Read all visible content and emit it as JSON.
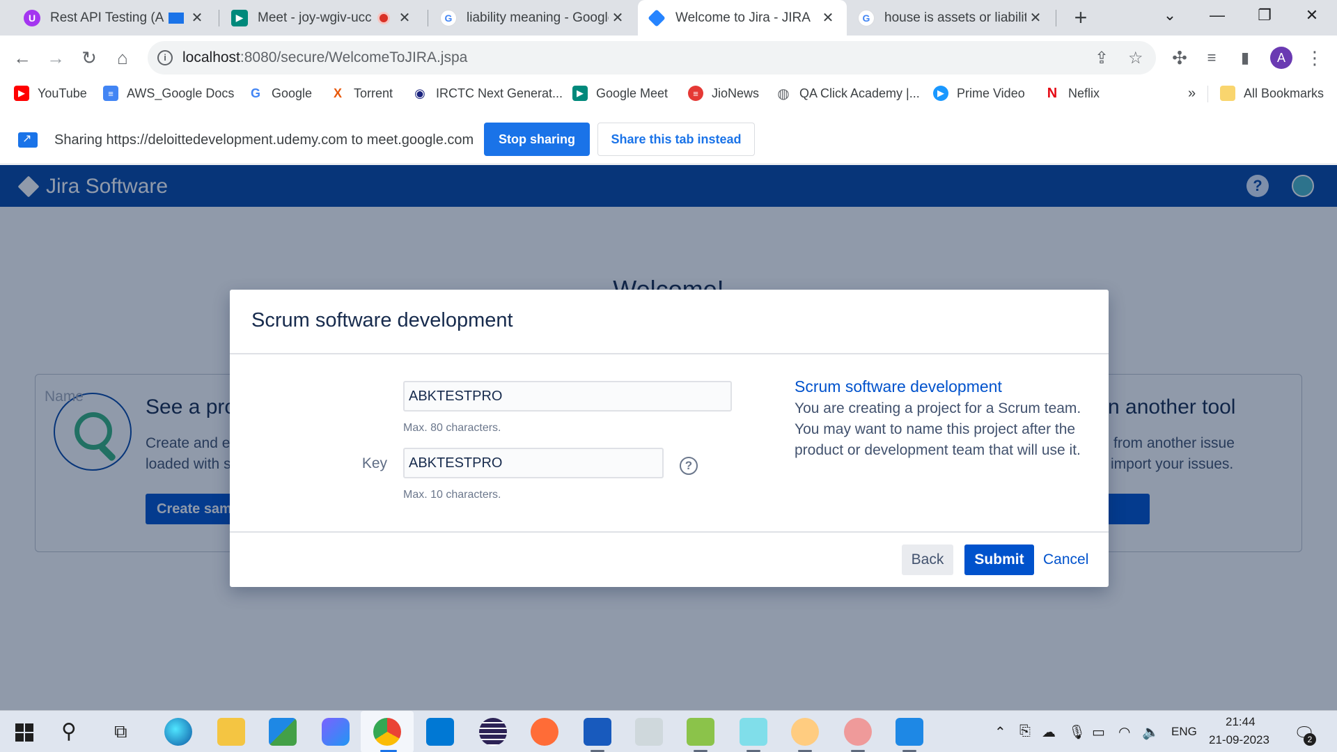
{
  "browser": {
    "tabs": [
      {
        "title": "Rest API Testing (Auto",
        "favicon": "udemy-icon",
        "color": "#a435f0",
        "active": false
      },
      {
        "title": "Meet - joy-wgiv-ucc",
        "favicon": "google-meet-icon",
        "color": "#00897b",
        "active": false
      },
      {
        "title": "liability meaning - Google",
        "favicon": "google-icon",
        "color": "#4285f4",
        "active": false
      },
      {
        "title": "Welcome to Jira - JIRA",
        "favicon": "jira-icon",
        "color": "#2684ff",
        "active": true
      },
      {
        "title": "house is assets or liabilities",
        "favicon": "google-icon",
        "color": "#4285f4",
        "active": false
      }
    ],
    "new_tab": "+",
    "url_host": "localhost",
    "url_path": ":8080/secure/WelcomeToJIRA.jspa",
    "profile_initial": "A"
  },
  "bookmarks": {
    "items": [
      {
        "label": "YouTube",
        "icon": "youtube-icon",
        "color": "#ff0000",
        "glyph": "▶"
      },
      {
        "label": "AWS_Google Docs",
        "icon": "google-docs-icon",
        "color": "#4285f4",
        "glyph": "≡"
      },
      {
        "label": "Google",
        "icon": "google-icon",
        "color": "#ffffff",
        "glyph": "G"
      },
      {
        "label": "Torrent",
        "icon": "torrent-icon",
        "color": "#ffffff",
        "glyph": "X"
      },
      {
        "label": "IRCTC Next Generat...",
        "icon": "irctc-icon",
        "color": "#ffffff",
        "glyph": "◉"
      },
      {
        "label": "Google Meet",
        "icon": "google-meet-icon",
        "color": "#00897b",
        "glyph": "▶"
      },
      {
        "label": "JioNews",
        "icon": "jionews-icon",
        "color": "#e53935",
        "glyph": "≡"
      },
      {
        "label": "QA Click Academy |...",
        "icon": "globe-icon",
        "color": "#5f6368",
        "glyph": "◍"
      },
      {
        "label": "Prime Video",
        "icon": "prime-video-icon",
        "color": "#1a98ff",
        "glyph": "▶"
      },
      {
        "label": "Neflix",
        "icon": "netflix-icon",
        "color": "#ffffff",
        "glyph": "N"
      }
    ],
    "overflow": "»",
    "all_bookmarks": "All Bookmarks"
  },
  "sharing": {
    "message": "Sharing https://deloittedevelopment.udemy.com to meet.google.com",
    "stop_label": "Stop sharing",
    "share_tab_label": "Share this tab instead"
  },
  "jira": {
    "product_name": "Jira Software",
    "welcome": "Welcome!",
    "left_card": {
      "heading": "See a pro",
      "line1": "Create and ex",
      "line2": "loaded with s",
      "button": "Create sam"
    },
    "right_card": {
      "heading": "n another tool",
      "line1": "from another issue",
      "line2": "import your issues."
    }
  },
  "dialog": {
    "title": "Scrum software development",
    "name_label": "Name",
    "name_value": "ABKTESTPRO",
    "name_hint": "Max. 80 characters.",
    "key_label": "Key",
    "key_value": "ABKTESTPRO",
    "key_hint": "Max. 10 characters.",
    "description_title": "Scrum software development",
    "description_text": "You are creating a project for a Scrum team. You may want to name this project after the product or development team that will use it.",
    "back_label": "Back",
    "submit_label": "Submit",
    "cancel_label": "Cancel"
  },
  "taskbar": {
    "language": "ENG",
    "time": "21:44",
    "date": "21-09-2023",
    "notification_count": "2"
  },
  "colors": {
    "jira_header": "#0747a6",
    "primary_button": "#0052cc",
    "chrome_blue": "#1a73e8"
  }
}
